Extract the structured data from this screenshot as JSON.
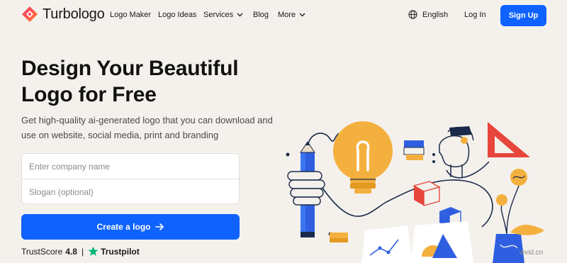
{
  "brand": {
    "name": "Turbologo",
    "logo_icon": "turbologo-diamond-icon",
    "colors": {
      "pink": "#ff3b6b",
      "red": "#ff5a3c",
      "blue": "#0f62fe"
    }
  },
  "nav": {
    "items": [
      {
        "label": "Logo Maker",
        "dropdown": false
      },
      {
        "label": "Logo Ideas",
        "dropdown": false
      },
      {
        "label": "Services",
        "dropdown": true
      },
      {
        "label": "Blog",
        "dropdown": false
      },
      {
        "label": "More",
        "dropdown": true
      }
    ],
    "language": {
      "icon": "globe-icon",
      "label": "English"
    },
    "login_label": "Log In",
    "signup_label": "Sign Up"
  },
  "hero": {
    "headline_line1": "Design Your Beautiful",
    "headline_line2": "Logo for Free",
    "subtext": "Get high-quality ai-generated logo that you can download and use on website, social media, print and branding",
    "company_placeholder": "Enter company name",
    "slogan_placeholder": "Slogan (optional)",
    "cta_label": "Create a logo",
    "cta_icon": "arrow-right-icon"
  },
  "trust": {
    "label": "TrustScore",
    "score": "4.8",
    "separator": "|",
    "provider": "Trustpilot",
    "star_color": "#00b67a"
  },
  "illustration": {
    "description": "designer-illustration",
    "accent_colors": [
      "#f4b03e",
      "#2f5fe0",
      "#e8463c"
    ]
  },
  "watermark": "wvid.cn"
}
